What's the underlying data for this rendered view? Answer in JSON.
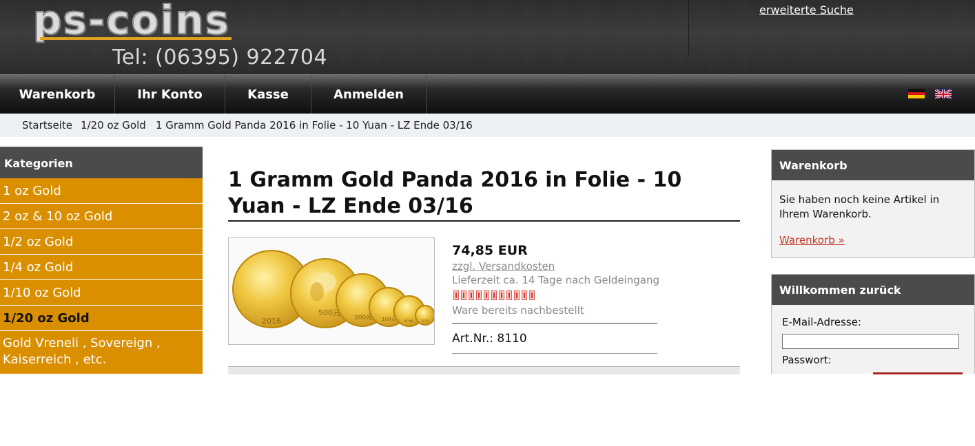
{
  "header": {
    "logo_text": "ps-coins",
    "phone": "Tel: (06395) 922704",
    "advanced_search": "erweiterte Suche"
  },
  "nav": {
    "items": [
      {
        "label": "Warenkorb"
      },
      {
        "label": "Ihr Konto"
      },
      {
        "label": "Kasse"
      },
      {
        "label": "Anmelden"
      }
    ],
    "languages": [
      "german-flag-icon",
      "english-flag-icon"
    ]
  },
  "breadcrumb": [
    "Startseite",
    "1/20 oz Gold",
    "1 Gramm Gold Panda 2016 in Folie - 10 Yuan - LZ Ende 03/16"
  ],
  "sidebar": {
    "title": "Kategorien",
    "categories": [
      {
        "label": "1 oz Gold"
      },
      {
        "label": "2 oz & 10 oz Gold"
      },
      {
        "label": "1/2 oz Gold"
      },
      {
        "label": "1/4 oz Gold"
      },
      {
        "label": "1/10 oz Gold"
      },
      {
        "label": "1/20 oz Gold",
        "active": true
      },
      {
        "label": "Gold Vreneli , Sovereign , Kaiserreich , etc."
      }
    ]
  },
  "product": {
    "title": "1 Gramm Gold Panda 2016 in Folie - 10 Yuan - LZ Ende 03/16",
    "price": "74,85 EUR",
    "shipping": "zzgl. Versandkosten",
    "delivery": "Lieferzeit ca. 14 Tage nach Geldeingang",
    "stock_indicator_count": 11,
    "status": "Ware bereits nachbestellt",
    "article_number": "Art.Nr.: 8110",
    "coin_labels": [
      "2016",
      "500元",
      "200元",
      "100元",
      "50元",
      "20元"
    ]
  },
  "cart_box": {
    "title": "Warenkorb",
    "text": "Sie haben noch keine Artikel in Ihrem Warenkorb.",
    "link": "Warenkorb »"
  },
  "login_box": {
    "title": "Willkommen zurück",
    "email_label": "E-Mail-Adresse:",
    "password_label": "Passwort:"
  },
  "colors": {
    "category_bg": "#d98f00",
    "box_header": "#4b4b4b",
    "link_red": "#c0392b",
    "stock_red": "#d9342b"
  }
}
